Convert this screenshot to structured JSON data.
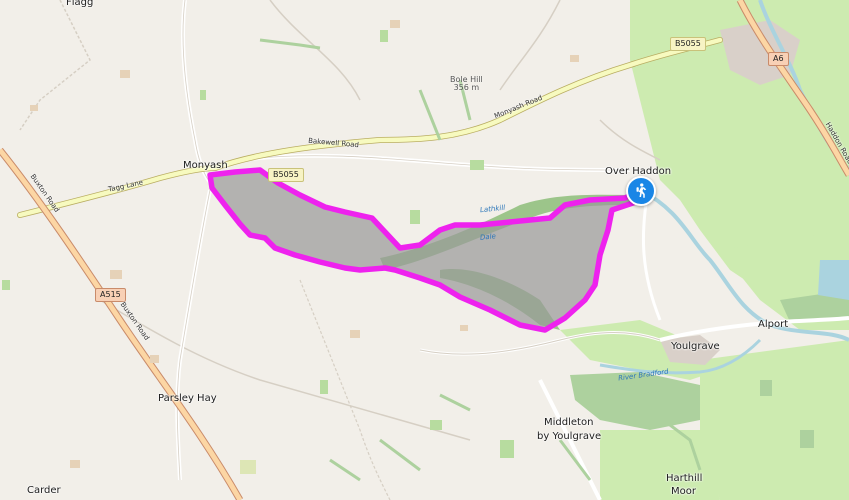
{
  "map": {
    "route_color": "#ee22ee",
    "marker_icon": "hiker-icon",
    "marker_color": "#1a86e6",
    "places": {
      "flagg": "Flagg",
      "monyash": "Monyash",
      "over_haddon": "Over Haddon",
      "alport": "Alport",
      "youlgrave": "Youlgrave",
      "parsley_hay": "Parsley Hay",
      "middleton": "Middleton",
      "middleton_2": "by Youlgrave",
      "carder": "Carder",
      "harthill": "Harthill",
      "harthill_2": "Moor"
    },
    "roads": {
      "b5055_east": "B5055",
      "b5055_west": "B5055",
      "a6": "A6",
      "a515": "A515",
      "bakewell_road": "Bakewell Road",
      "monyash_road": "Monyash Road",
      "tagg_lane": "Tagg Lane",
      "buxton_road": "Buxton Road",
      "buxton_road_2": "Buxton Road",
      "haddon_road": "Haddon Road"
    },
    "peak": {
      "name": "Bole Hill",
      "elevation": "356 m"
    },
    "water": {
      "river": "River Bradford",
      "lathkill": "Lathkill",
      "lathkill_2": "Dale"
    }
  }
}
